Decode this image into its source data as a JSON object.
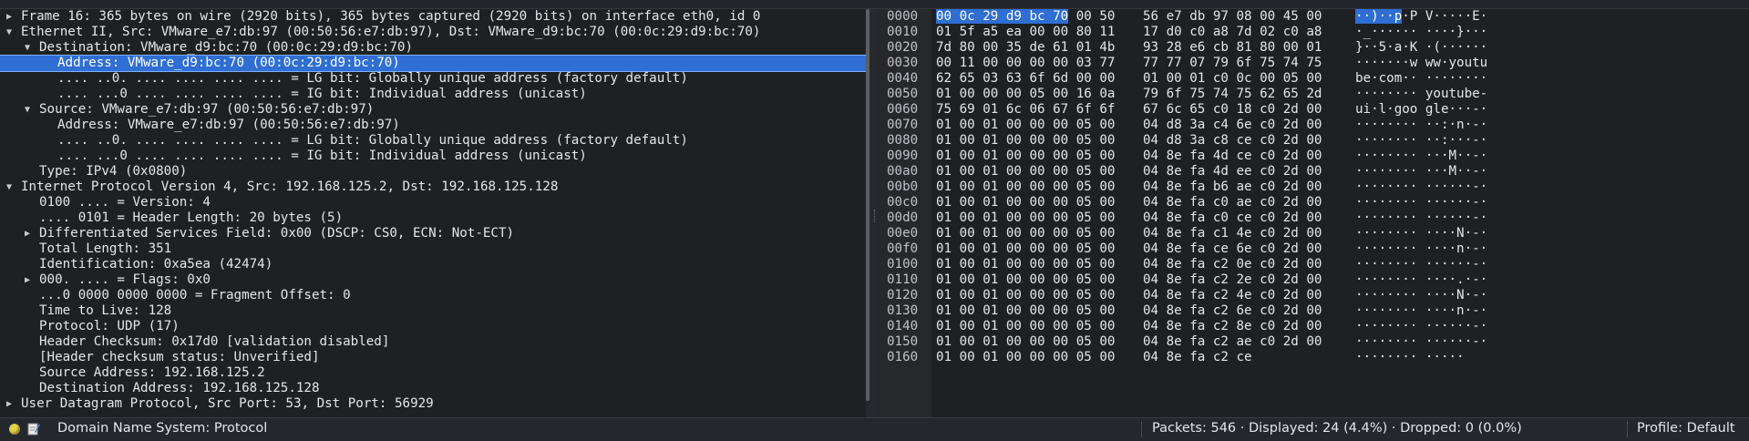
{
  "details": {
    "rows": [
      {
        "text": "Frame 16: 365 bytes on wire (2920 bits), 365 bytes captured (2920 bits) on interface eth0, id 0",
        "level": 0,
        "arrow": "right"
      },
      {
        "text": "Ethernet II, Src: VMware_e7:db:97 (00:50:56:e7:db:97), Dst: VMware_d9:bc:70 (00:0c:29:d9:bc:70)",
        "level": 0,
        "arrow": "down"
      },
      {
        "text": "Destination: VMware_d9:bc:70 (00:0c:29:d9:bc:70)",
        "level": 1,
        "arrow": "down"
      },
      {
        "text": "Address: VMware_d9:bc:70 (00:0c:29:d9:bc:70)",
        "level": 2,
        "arrow": "",
        "selected": true
      },
      {
        "text": ".... ..0. .... .... .... .... = LG bit: Globally unique address (factory default)",
        "level": 2,
        "arrow": ""
      },
      {
        "text": ".... ...0 .... .... .... .... = IG bit: Individual address (unicast)",
        "level": 2,
        "arrow": ""
      },
      {
        "text": "Source: VMware_e7:db:97 (00:50:56:e7:db:97)",
        "level": 1,
        "arrow": "down"
      },
      {
        "text": "Address: VMware_e7:db:97 (00:50:56:e7:db:97)",
        "level": 2,
        "arrow": ""
      },
      {
        "text": ".... ..0. .... .... .... .... = LG bit: Globally unique address (factory default)",
        "level": 2,
        "arrow": ""
      },
      {
        "text": ".... ...0 .... .... .... .... = IG bit: Individual address (unicast)",
        "level": 2,
        "arrow": ""
      },
      {
        "text": "Type: IPv4 (0x0800)",
        "level": 1,
        "arrow": ""
      },
      {
        "text": "Internet Protocol Version 4, Src: 192.168.125.2, Dst: 192.168.125.128",
        "level": 0,
        "arrow": "down"
      },
      {
        "text": "0100 .... = Version: 4",
        "level": 1,
        "arrow": ""
      },
      {
        "text": ".... 0101 = Header Length: 20 bytes (5)",
        "level": 1,
        "arrow": ""
      },
      {
        "text": "Differentiated Services Field: 0x00 (DSCP: CS0, ECN: Not-ECT)",
        "level": 1,
        "arrow": "right"
      },
      {
        "text": "Total Length: 351",
        "level": 1,
        "arrow": ""
      },
      {
        "text": "Identification: 0xa5ea (42474)",
        "level": 1,
        "arrow": ""
      },
      {
        "text": "000. .... = Flags: 0x0",
        "level": 1,
        "arrow": "right"
      },
      {
        "text": "...0 0000 0000 0000 = Fragment Offset: 0",
        "level": 1,
        "arrow": ""
      },
      {
        "text": "Time to Live: 128",
        "level": 1,
        "arrow": ""
      },
      {
        "text": "Protocol: UDP (17)",
        "level": 1,
        "arrow": ""
      },
      {
        "text": "Header Checksum: 0x17d0 [validation disabled]",
        "level": 1,
        "arrow": ""
      },
      {
        "text": "[Header checksum status: Unverified]",
        "level": 1,
        "arrow": ""
      },
      {
        "text": "Source Address: 192.168.125.2",
        "level": 1,
        "arrow": ""
      },
      {
        "text": "Destination Address: 192.168.125.128",
        "level": 1,
        "arrow": ""
      },
      {
        "text": "User Datagram Protocol, Src Port: 53, Dst Port: 56929",
        "level": 0,
        "arrow": "right"
      }
    ]
  },
  "bytes": {
    "rows": [
      {
        "offset": "0000",
        "hex_a": "00 0c 29 d9 bc 70 00 50",
        "hex_b": "56 e7 db 97 08 00 45 00",
        "ascii": "··)··p·P V·····E·",
        "hl_hex": 6,
        "hl_ascii": 6
      },
      {
        "offset": "0010",
        "hex_a": "01 5f a5 ea 00 00 80 11",
        "hex_b": "17 d0 c0 a8 7d 02 c0 a8",
        "ascii": "·_······ ····}···"
      },
      {
        "offset": "0020",
        "hex_a": "7d 80 00 35 de 61 01 4b",
        "hex_b": "93 28 e6 cb 81 80 00 01",
        "ascii": "}··5·a·K ·(······"
      },
      {
        "offset": "0030",
        "hex_a": "00 11 00 00 00 00 03 77",
        "hex_b": "77 77 07 79 6f 75 74 75",
        "ascii": "·······w ww·youtu"
      },
      {
        "offset": "0040",
        "hex_a": "62 65 03 63 6f 6d 00 00",
        "hex_b": "01 00 01 c0 0c 00 05 00",
        "ascii": "be·com·· ········"
      },
      {
        "offset": "0050",
        "hex_a": "01 00 00 00 05 00 16 0a",
        "hex_b": "79 6f 75 74 75 62 65 2d",
        "ascii": "········ youtube-"
      },
      {
        "offset": "0060",
        "hex_a": "75 69 01 6c 06 67 6f 6f",
        "hex_b": "67 6c 65 c0 18 c0 2d 00",
        "ascii": "ui·l·goo gle···-·"
      },
      {
        "offset": "0070",
        "hex_a": "01 00 01 00 00 00 05 00",
        "hex_b": "04 d8 3a c4 6e c0 2d 00",
        "ascii": "········ ··:·n·-·"
      },
      {
        "offset": "0080",
        "hex_a": "01 00 01 00 00 00 05 00",
        "hex_b": "04 d8 3a c8 ce c0 2d 00",
        "ascii": "········ ··:···-·"
      },
      {
        "offset": "0090",
        "hex_a": "01 00 01 00 00 00 05 00",
        "hex_b": "04 8e fa 4d ce c0 2d 00",
        "ascii": "········ ···M··-·"
      },
      {
        "offset": "00a0",
        "hex_a": "01 00 01 00 00 00 05 00",
        "hex_b": "04 8e fa 4d ee c0 2d 00",
        "ascii": "········ ···M··-·"
      },
      {
        "offset": "00b0",
        "hex_a": "01 00 01 00 00 00 05 00",
        "hex_b": "04 8e fa b6 ae c0 2d 00",
        "ascii": "········ ······-·"
      },
      {
        "offset": "00c0",
        "hex_a": "01 00 01 00 00 00 05 00",
        "hex_b": "04 8e fa c0 ae c0 2d 00",
        "ascii": "········ ······-·"
      },
      {
        "offset": "00d0",
        "hex_a": "01 00 01 00 00 00 05 00",
        "hex_b": "04 8e fa c0 ce c0 2d 00",
        "ascii": "········ ······-·"
      },
      {
        "offset": "00e0",
        "hex_a": "01 00 01 00 00 00 05 00",
        "hex_b": "04 8e fa c1 4e c0 2d 00",
        "ascii": "········ ····N·-·"
      },
      {
        "offset": "00f0",
        "hex_a": "01 00 01 00 00 00 05 00",
        "hex_b": "04 8e fa ce 6e c0 2d 00",
        "ascii": "········ ····n·-·"
      },
      {
        "offset": "0100",
        "hex_a": "01 00 01 00 00 00 05 00",
        "hex_b": "04 8e fa c2 0e c0 2d 00",
        "ascii": "········ ······-·"
      },
      {
        "offset": "0110",
        "hex_a": "01 00 01 00 00 00 05 00",
        "hex_b": "04 8e fa c2 2e c0 2d 00",
        "ascii": "········ ····.·-·"
      },
      {
        "offset": "0120",
        "hex_a": "01 00 01 00 00 00 05 00",
        "hex_b": "04 8e fa c2 4e c0 2d 00",
        "ascii": "········ ····N·-·"
      },
      {
        "offset": "0130",
        "hex_a": "01 00 01 00 00 00 05 00",
        "hex_b": "04 8e fa c2 6e c0 2d 00",
        "ascii": "········ ····n·-·"
      },
      {
        "offset": "0140",
        "hex_a": "01 00 01 00 00 00 05 00",
        "hex_b": "04 8e fa c2 8e c0 2d 00",
        "ascii": "········ ······-·"
      },
      {
        "offset": "0150",
        "hex_a": "01 00 01 00 00 00 05 00",
        "hex_b": "04 8e fa c2 ae c0 2d 00",
        "ascii": "········ ······-·"
      },
      {
        "offset": "0160",
        "hex_a": "01 00 01 00 00 00 05 00",
        "hex_b": "04 8e fa c2 ce",
        "ascii": "········ ·····"
      }
    ]
  },
  "status": {
    "field_info": "Domain Name System: Protocol",
    "stats": "Packets: 546 · Displayed: 24 (4.4%) · Dropped: 0 (0.0%)",
    "profile": "Profile: Default",
    "indicator_icon": "ready-indicator-icon",
    "edit_icon": "edit-comment-icon"
  },
  "colors": {
    "selection": "#2f6ed3",
    "background": "#1e2024",
    "text": "#e4e6ea"
  }
}
